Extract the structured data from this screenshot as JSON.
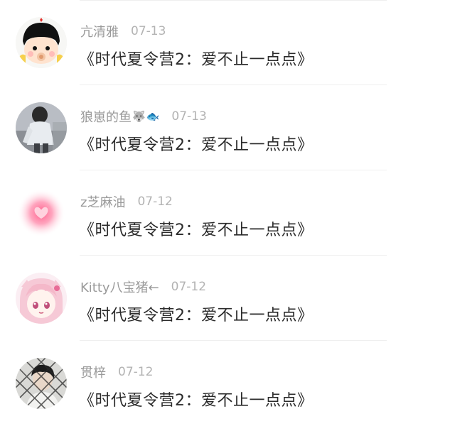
{
  "comments": [
    {
      "username": "亢清雅",
      "badges": [],
      "time": "07-13",
      "text": "《时代夏令营2：爱不止一点点》",
      "avatar": "cartoon-child-avatar"
    },
    {
      "username": "狼崽的鱼",
      "badges": [
        "🐺",
        "🐟"
      ],
      "time": "07-13",
      "text": "《时代夏令营2：爱不止一点点》",
      "avatar": "person-photo-avatar"
    },
    {
      "username": "z芝麻油",
      "badges": [],
      "time": "07-12",
      "text": "《时代夏令营2：爱不止一点点》",
      "avatar": "pink-heart-glow-avatar"
    },
    {
      "username": "Kitty八宝猪←",
      "badges": [],
      "time": "07-12",
      "text": "《时代夏令营2：爱不止一点点》",
      "avatar": "anime-girl-avatar"
    },
    {
      "username": "贯梓",
      "badges": [],
      "time": "07-12",
      "text": "《时代夏令营2：爱不止一点点》",
      "avatar": "person-behind-net-avatar"
    }
  ],
  "colors": {
    "username": "#9a9a9a",
    "timestamp": "#b3b3b3",
    "content": "#2b2b2b",
    "divider": "#efefef"
  }
}
